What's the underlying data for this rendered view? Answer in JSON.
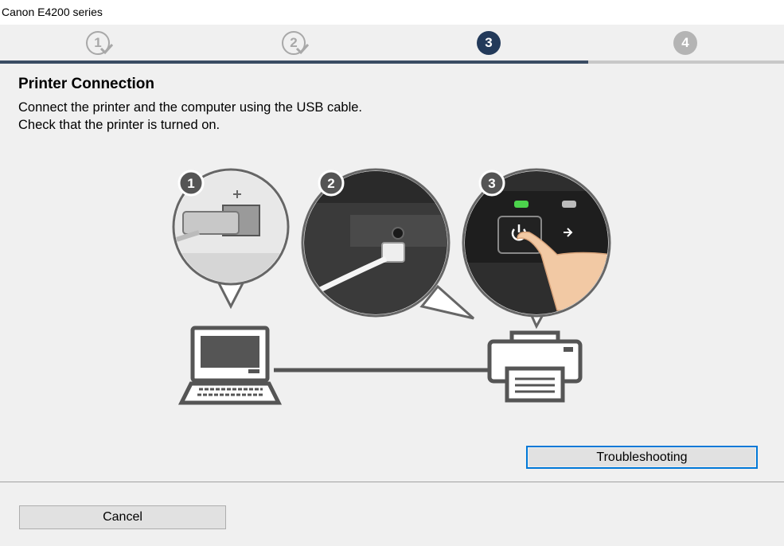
{
  "window": {
    "title": "Canon E4200 series"
  },
  "steps": [
    {
      "label": "1",
      "state": "done"
    },
    {
      "label": "2",
      "state": "done"
    },
    {
      "label": "3",
      "state": "current"
    },
    {
      "label": "4",
      "state": "pending"
    }
  ],
  "progress": {
    "fraction": 0.75
  },
  "content": {
    "heading": "Printer Connection",
    "line1": "Connect the printer and the computer using the USB cable.",
    "line2": "Check that the printer is turned on."
  },
  "illustration": {
    "callout1_number": "1",
    "callout2_number": "2",
    "callout3_number": "3"
  },
  "buttons": {
    "troubleshooting": "Troubleshooting",
    "cancel": "Cancel"
  },
  "colors": {
    "accent": "#233a5a",
    "focus": "#0078d7",
    "power_led": "#4cd44c"
  }
}
